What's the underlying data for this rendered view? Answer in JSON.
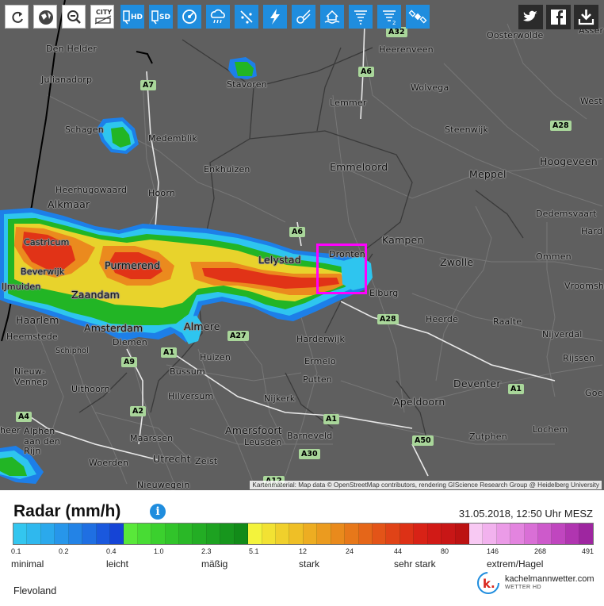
{
  "toolbar": [
    {
      "name": "refresh-button",
      "icon": "refresh-icon",
      "label": ""
    },
    {
      "name": "globe-button",
      "icon": "globe-icon",
      "label": ""
    },
    {
      "name": "zoom-out-button",
      "icon": "zoom-out-icon",
      "label": ""
    },
    {
      "name": "city-toggle-button",
      "icon": "city-icon",
      "label": "CITY"
    },
    {
      "name": "sat-hd-button",
      "icon": "satellite-hd-icon",
      "label": "HD"
    },
    {
      "name": "sat-sd-button",
      "icon": "satellite-sd-icon",
      "label": "SD"
    },
    {
      "name": "radar-button",
      "icon": "radar-icon",
      "label": ""
    },
    {
      "name": "rain-button",
      "icon": "rain-cloud-icon",
      "label": ""
    },
    {
      "name": "hail-button",
      "icon": "hail-icon",
      "label": ""
    },
    {
      "name": "lightning-button",
      "icon": "lightning-icon",
      "label": ""
    },
    {
      "name": "meteor-button",
      "icon": "meteor-icon",
      "label": ""
    },
    {
      "name": "flood-button",
      "icon": "flood-icon",
      "label": ""
    },
    {
      "name": "tornado-button",
      "icon": "tornado-icon",
      "label": ""
    },
    {
      "name": "tornado2-button",
      "icon": "tornado-2-icon",
      "label": ""
    },
    {
      "name": "satellite-button",
      "icon": "satellite-icon",
      "label": ""
    }
  ],
  "social": [
    {
      "name": "twitter-button",
      "icon": "twitter-icon"
    },
    {
      "name": "facebook-button",
      "icon": "facebook-icon"
    },
    {
      "name": "download-button",
      "icon": "download-icon"
    }
  ],
  "map": {
    "attribution": "Kartenmaterial: Map data © OpenStreetMap contributors, rendering GIScience Research Group @ Heidelberg University",
    "cities": {
      "den_helder": "Den Helder",
      "julianadorp": "Julianadorp",
      "schagen": "Schagen",
      "medemblik": "Medemblik",
      "stavoren": "Stavoren",
      "heerenveen": "Heerenveen",
      "oosterwolde": "Oosterwolde",
      "assen": "Asser",
      "wolvega": "Wolvega",
      "lemmer": "Lemmer",
      "west": "West",
      "steenwijk": "Steenwijk",
      "enkhuizen": "Enkhuizen",
      "emmeloord": "Emmeloord",
      "meppel": "Meppel",
      "hoogeveen": "Hoogeveen",
      "heerhugowaard": "Heerhugowaard",
      "hoorn": "Hoorn",
      "alkmaar": "Alkmaar",
      "dedemsvaart": "Dedemsvaart",
      "hard": "Hard",
      "castricum": "Castricum",
      "beverwijk": "Beverwijk",
      "ijmuiden": "IJmuiden",
      "purmerend": "Purmerend",
      "lelystad": "Lelystad",
      "dronten": "Dronten",
      "kampen": "Kampen",
      "zwolle": "Zwolle",
      "ommen": "Ommen",
      "vroomsh": "Vroomsh",
      "zaandam": "Zaandam",
      "elburg": "Elburg",
      "haarlem": "Haarlem",
      "amsterdam": "Amsterdam",
      "almere": "Almere",
      "heemstede": "Heemstede",
      "diemen": "Diemen",
      "harderwijk": "Harderwijk",
      "heerde": "Heerde",
      "raalte": "Raalte",
      "nijverdal": "Nijverdal",
      "schiphol": "Schiphol",
      "huizen": "Huizen",
      "ermelo": "Ermelo",
      "rijssen": "Rijssen",
      "nieuw_vennep": "Nieuw-\nVennep",
      "bussum": "Bussum",
      "putten": "Putten",
      "uithoorn": "Uithoorn",
      "deventer": "Deventer",
      "hilversum": "Hilversum",
      "nijkerk": "Nijkerk",
      "apeldoorn": "Apeldoorn",
      "goor": "Goe",
      "alphen": "Alphen\naan den\nRijn",
      "amersfoort": "Amersfoort",
      "leusden": "Leusden",
      "barneveld": "Barneveld",
      "lochem": "Lochem",
      "maarssen": "Maarssen",
      "zutphen": "Zutphen",
      "woerden": "Woerden",
      "utrecht": "Utrecht",
      "zeist": "Zeist",
      "nieuwegein": "Nieuwegein",
      "heer": "heer"
    },
    "roads": {
      "a32": "A32",
      "a6a": "A6",
      "a7": "A7",
      "a28a": "A28",
      "a6b": "A6",
      "a28b": "A28",
      "a27": "A27",
      "a1a": "A1",
      "a9": "A9",
      "a1b": "A1",
      "a2": "A2",
      "a1c": "A1",
      "a4": "A4",
      "a50": "A50",
      "a30": "A30",
      "a12": "A12"
    }
  },
  "legend": {
    "title": "Radar (mm/h)",
    "datetime": "31.05.2018, 12:50 Uhr MESZ",
    "ticks": [
      "0.1",
      "0.2",
      "0.4",
      "1.0",
      "2.3",
      "5.1",
      "12",
      "24",
      "44",
      "80",
      "146",
      "268",
      "491"
    ],
    "categories": [
      "minimal",
      "leicht",
      "mäßig",
      "stark",
      "sehr stark",
      "extrem/Hagel"
    ],
    "region": "Flevoland",
    "brand": "kachelmannwetter.com",
    "brand_sub": "WETTER HD",
    "colors": [
      "#33c6ef",
      "#2fb8ee",
      "#2ba9ec",
      "#2796ea",
      "#2383e6",
      "#1f6fe2",
      "#1a58dd",
      "#1544d6",
      "#59e83a",
      "#48dc34",
      "#3bd02e",
      "#31c42a",
      "#2ab827",
      "#23ad24",
      "#1da221",
      "#17961d",
      "#128b19",
      "#f3f33c",
      "#f2e233",
      "#f0d02c",
      "#efbf26",
      "#edad22",
      "#eb9b1f",
      "#e98a1c",
      "#e7781a",
      "#e56619",
      "#e35418",
      "#e04317",
      "#dd3116",
      "#d82216",
      "#d11a16",
      "#c81616",
      "#bc1212",
      "#f8c9f3",
      "#f2b2ee",
      "#eb9be7",
      "#e384df",
      "#d96fd6",
      "#cd5acb",
      "#c046bf",
      "#b035b0",
      "#9e26a0"
    ]
  }
}
